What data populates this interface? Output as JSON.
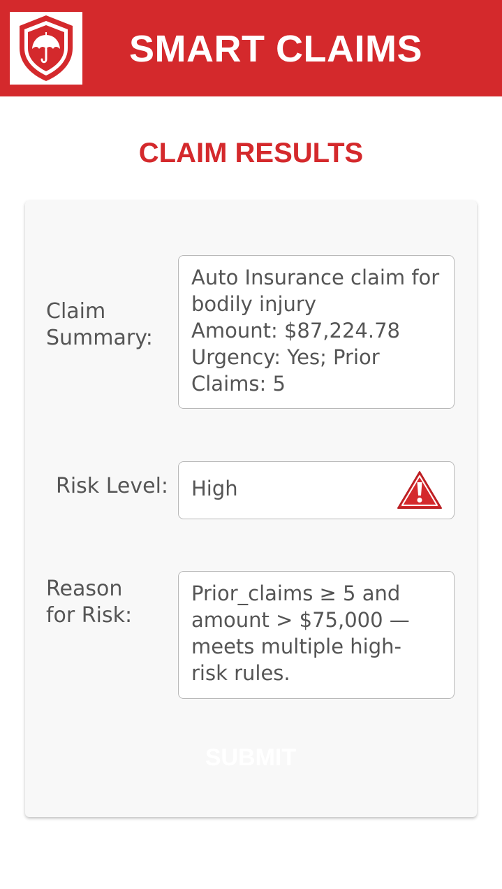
{
  "header": {
    "app_title": "SMART CLAIMS",
    "logo_icon": "shield-umbrella-icon",
    "bg_color": "#d4292c"
  },
  "page": {
    "title": "CLAIM RESULTS"
  },
  "claim_summary": {
    "label": "Claim\nSummary:",
    "value": "Auto Insurance claim for\nbodily injury\nAmount: $87,224.78\nUrgency: Yes; Prior\nClaims: 5"
  },
  "risk_level": {
    "label": "Risk Level:",
    "value": "High",
    "icon": "warning-triangle-icon"
  },
  "risk_reason": {
    "label": "Reason\nfor Risk:",
    "value": "Prior_claims ≥ 5 and\namount > $75,000 —\nmeets multiple high-\nrisk rules."
  },
  "actions": {
    "submit_label": "SUBMIT"
  }
}
